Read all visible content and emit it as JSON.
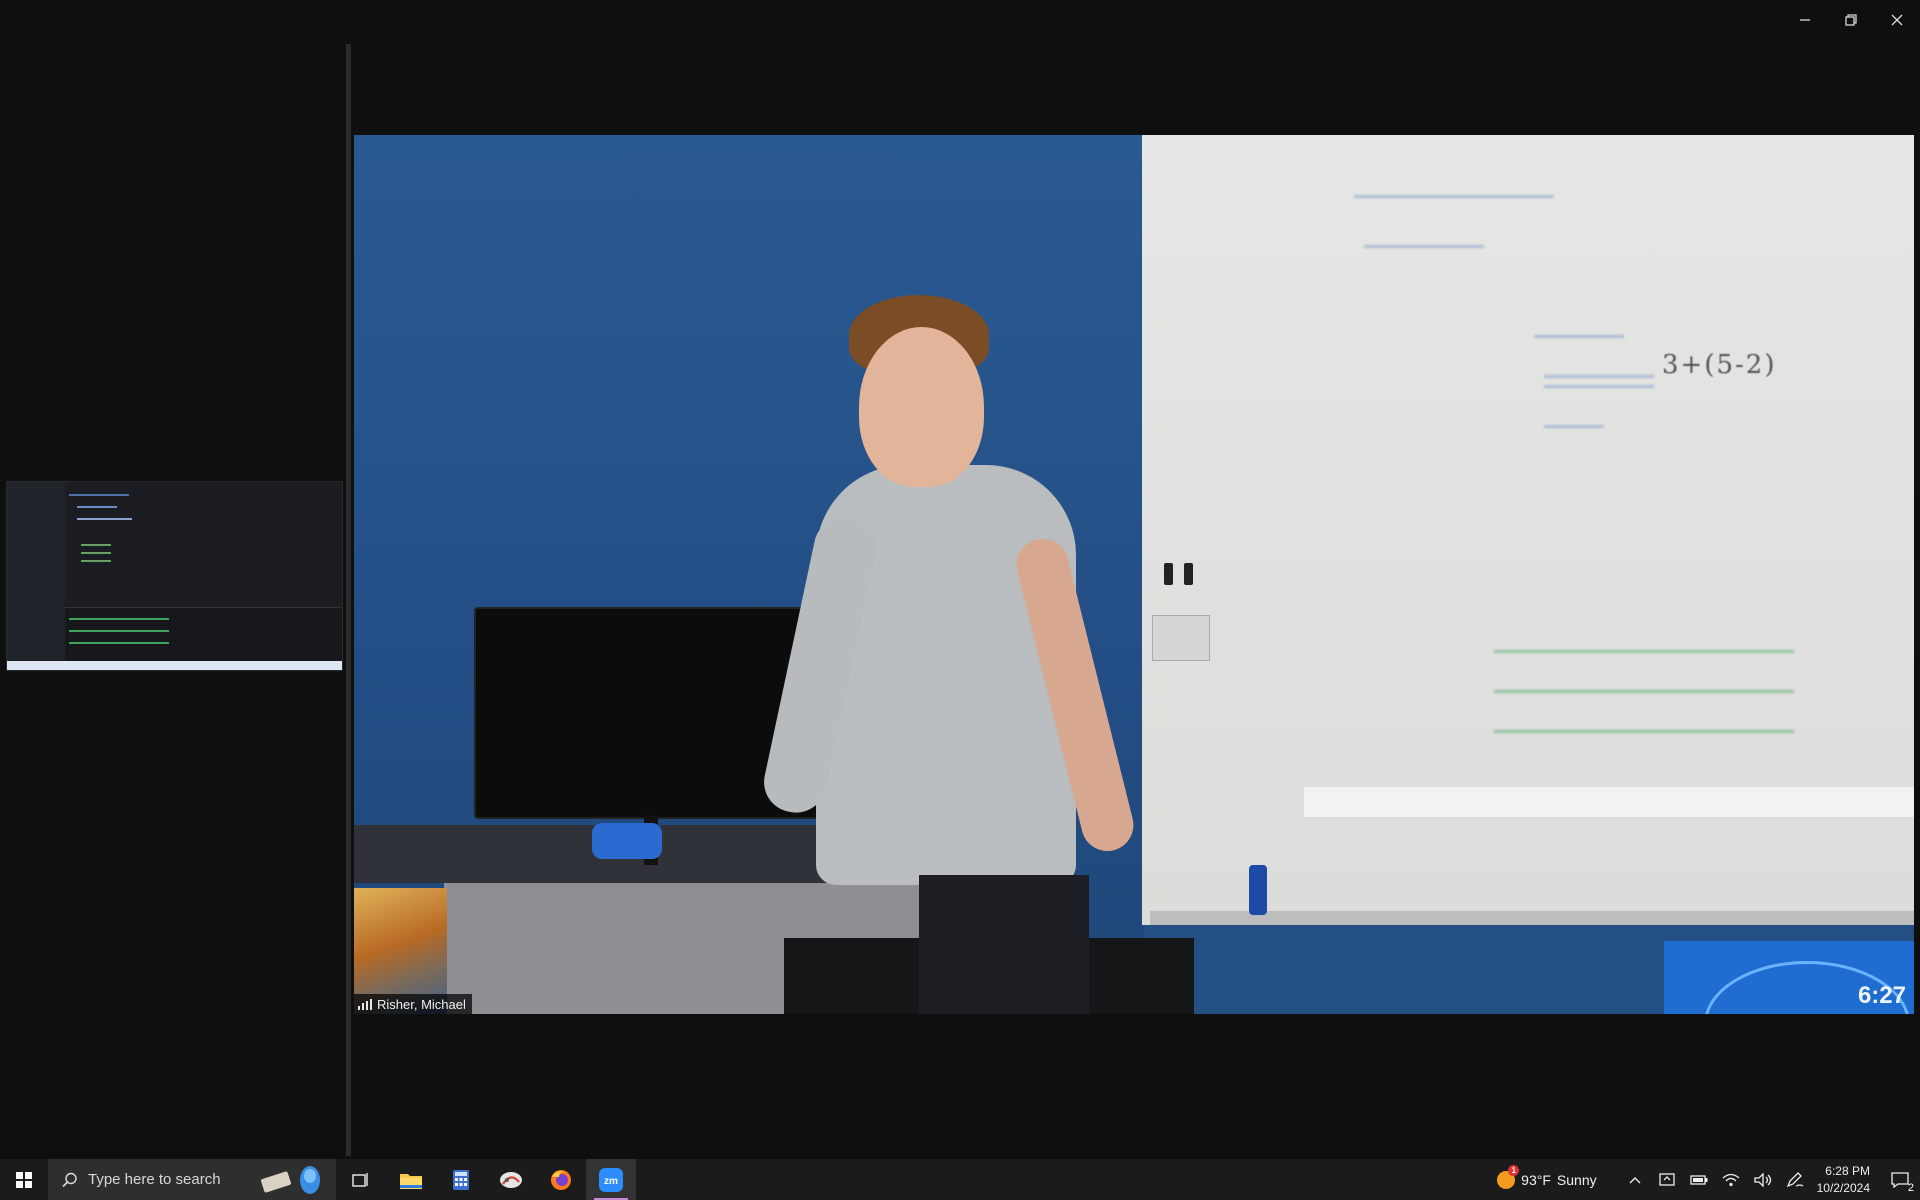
{
  "window": {
    "controls": [
      "minimize",
      "restore",
      "close"
    ]
  },
  "video": {
    "participant_name": "Risher, Michael",
    "whiteboard_text": "3+(5-2)",
    "room_clock": "6:27"
  },
  "taskbar": {
    "search_placeholder": "Type here to search",
    "apps": [
      {
        "name": "task-view",
        "icon": "task-view-icon"
      },
      {
        "name": "file-explorer",
        "icon": "folder-icon"
      },
      {
        "name": "calculator",
        "icon": "calculator-icon"
      },
      {
        "name": "snipping-tool",
        "icon": "snipping-tool-icon"
      },
      {
        "name": "firefox",
        "icon": "firefox-icon"
      },
      {
        "name": "zoom",
        "icon": "zoom-icon",
        "label": "zm",
        "active": true
      }
    ],
    "weather": {
      "temp": "93°F",
      "condition": "Sunny",
      "alert_count": "1"
    },
    "clock": {
      "time": "6:28 PM",
      "date": "10/2/2024"
    },
    "notifications_count": "2"
  },
  "colors": {
    "background": "#0f0f0f",
    "taskbar": "#1b1b1b",
    "zoom_accent": "#2d8cff"
  }
}
